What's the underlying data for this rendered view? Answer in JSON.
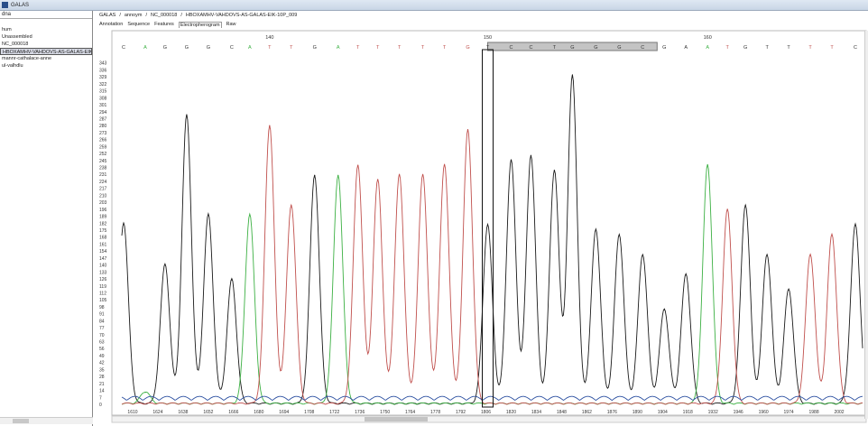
{
  "window": {
    "title": "GALAS"
  },
  "sidebar": {
    "search": "dna",
    "items": [
      {
        "label": ""
      },
      {
        "label": "hum"
      },
      {
        "label": "Unassembled"
      },
      {
        "label": "NC_000018"
      },
      {
        "label": "HBOXAMHV-VAHDOVS-AS-GALAS-EIK",
        "selected": true
      },
      {
        "label": "mannr-cathalace-anne"
      },
      {
        "label": "ul-valhdlu"
      }
    ]
  },
  "breadcrumb": [
    "GALAS",
    "/",
    "annoym",
    "/",
    "NC_000018",
    "/",
    "HBOXAMHV-VAHDOVS-AS-GALAS-EIK-10P_009"
  ],
  "tabs": [
    {
      "label": "Annotation"
    },
    {
      "label": "Sequence"
    },
    {
      "label": "Features"
    },
    {
      "label": "Electropherogram",
      "active": true
    },
    {
      "label": "Raw"
    }
  ],
  "colors": {
    "G": "#1a1a1a",
    "A": "#3cb043",
    "T": "#c0504d",
    "C": "#2b4fa0"
  },
  "chart_data": {
    "type": "line",
    "title": "Electropherogram",
    "xlim": [
      1604,
      2015
    ],
    "ylim": [
      0,
      350
    ],
    "x_ticks": [
      1610,
      1624,
      1638,
      1652,
      1666,
      1680,
      1694,
      1708,
      1722,
      1736,
      1750,
      1764,
      1778,
      1792,
      1806,
      1820,
      1834,
      1848,
      1862,
      1876,
      1890,
      1904,
      1918,
      1932,
      1946,
      1960,
      1974,
      1988,
      2002
    ],
    "y_ticks": [
      343,
      336,
      329,
      322,
      315,
      308,
      301,
      294,
      287,
      280,
      273,
      266,
      259,
      252,
      245,
      238,
      231,
      224,
      217,
      210,
      203,
      196,
      189,
      182,
      175,
      168,
      161,
      154,
      147,
      140,
      133,
      126,
      119,
      112,
      105,
      98,
      91,
      84,
      77,
      70,
      63,
      56,
      49,
      42,
      35,
      28,
      21,
      14,
      7,
      0
    ],
    "position_labels": [
      {
        "pos": "140",
        "scan": 1686
      },
      {
        "pos": "150",
        "scan": 1807
      },
      {
        "pos": "160",
        "scan": 1929
      }
    ],
    "selected_scan": 1807,
    "selection_range": [
      1807,
      1901
    ],
    "bases": [
      {
        "b": "C",
        "scan": 1605,
        "h": 182,
        "ch": "G"
      },
      {
        "b": "A",
        "scan": 1617,
        "h": 12,
        "ch": "A"
      },
      {
        "b": "G",
        "scan": 1628,
        "h": 140,
        "ch": "G"
      },
      {
        "b": "G",
        "scan": 1640,
        "h": 290,
        "ch": "G"
      },
      {
        "b": "G",
        "scan": 1652,
        "h": 190,
        "ch": "G"
      },
      {
        "b": "C",
        "scan": 1665,
        "h": 125,
        "ch": "G"
      },
      {
        "b": "A",
        "scan": 1675,
        "h": 190,
        "ch": "A"
      },
      {
        "b": "T",
        "scan": 1686,
        "h": 280,
        "ch": "T"
      },
      {
        "b": "T",
        "scan": 1698,
        "h": 200,
        "ch": "T"
      },
      {
        "b": "G",
        "scan": 1711,
        "h": 230,
        "ch": "G"
      },
      {
        "b": "A",
        "scan": 1724,
        "h": 230,
        "ch": "A"
      },
      {
        "b": "T",
        "scan": 1735,
        "h": 240,
        "ch": "T"
      },
      {
        "b": "T",
        "scan": 1746,
        "h": 225,
        "ch": "T"
      },
      {
        "b": "T",
        "scan": 1758,
        "h": 230,
        "ch": "T"
      },
      {
        "b": "T",
        "scan": 1771,
        "h": 230,
        "ch": "T"
      },
      {
        "b": "T",
        "scan": 1783,
        "h": 240,
        "ch": "T"
      },
      {
        "b": "G",
        "scan": 1796,
        "h": 275,
        "ch": "T"
      },
      {
        "b": "T",
        "scan": 1807,
        "h": 180,
        "ch": "G"
      },
      {
        "b": "C",
        "scan": 1820,
        "h": 245,
        "ch": "G"
      },
      {
        "b": "C",
        "scan": 1831,
        "h": 250,
        "ch": "G"
      },
      {
        "b": "T",
        "scan": 1844,
        "h": 235,
        "ch": "G"
      },
      {
        "b": "G",
        "scan": 1854,
        "h": 330,
        "ch": "G"
      },
      {
        "b": "G",
        "scan": 1867,
        "h": 175,
        "ch": "G"
      },
      {
        "b": "G",
        "scan": 1880,
        "h": 170,
        "ch": "G"
      },
      {
        "b": "C",
        "scan": 1893,
        "h": 150,
        "ch": "G"
      },
      {
        "b": "G",
        "scan": 1905,
        "h": 95,
        "ch": "G"
      },
      {
        "b": "A",
        "scan": 1917,
        "h": 130,
        "ch": "G"
      },
      {
        "b": "A",
        "scan": 1929,
        "h": 240,
        "ch": "A"
      },
      {
        "b": "T",
        "scan": 1940,
        "h": 195,
        "ch": "T"
      },
      {
        "b": "G",
        "scan": 1950,
        "h": 200,
        "ch": "G"
      },
      {
        "b": "T",
        "scan": 1962,
        "h": 150,
        "ch": "G"
      },
      {
        "b": "T",
        "scan": 1974,
        "h": 115,
        "ch": "G"
      },
      {
        "b": "T",
        "scan": 1986,
        "h": 150,
        "ch": "T"
      },
      {
        "b": "T",
        "scan": 1998,
        "h": 170,
        "ch": "T"
      },
      {
        "b": "C",
        "scan": 2011,
        "h": 180,
        "ch": "G"
      }
    ]
  }
}
